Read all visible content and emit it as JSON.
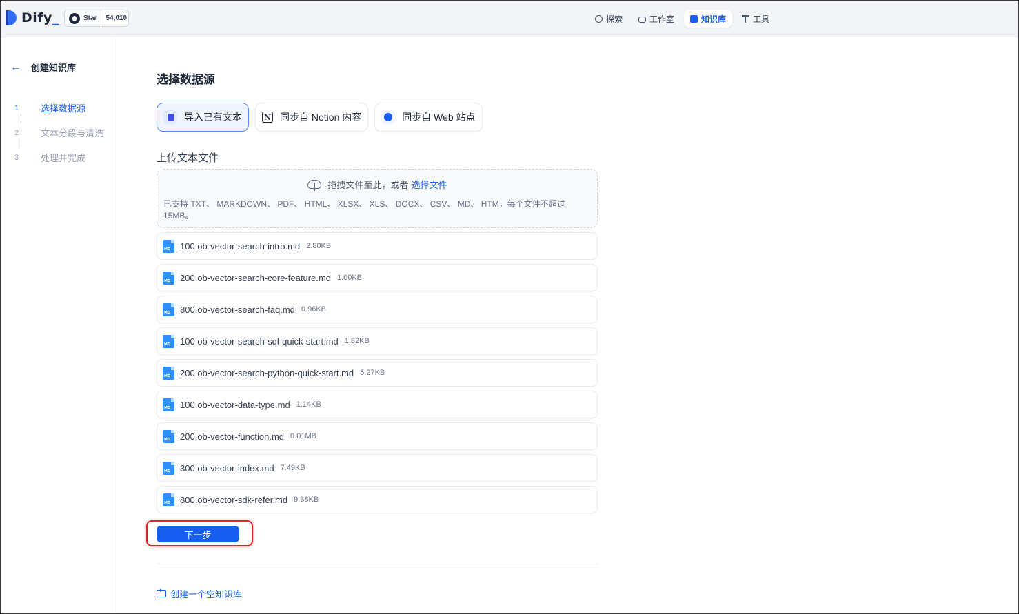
{
  "header": {
    "logo_text": "Dify",
    "github": {
      "star_label": "Star",
      "star_count": "54,010"
    },
    "nav": [
      {
        "label": "探索",
        "icon": "explore-icon",
        "active": false
      },
      {
        "label": "工作室",
        "icon": "studio-icon",
        "active": false
      },
      {
        "label": "知识库",
        "icon": "knowledge-icon",
        "active": true
      },
      {
        "label": "工具",
        "icon": "tools-icon",
        "active": false
      }
    ]
  },
  "sidebar": {
    "back_icon": "arrow-left-icon",
    "title": "创建知识库",
    "steps": [
      {
        "num": "1",
        "label": "选择数据源",
        "active": true
      },
      {
        "num": "2",
        "label": "文本分段与清洗",
        "active": false
      },
      {
        "num": "3",
        "label": "处理并完成",
        "active": false
      }
    ]
  },
  "main": {
    "title": "选择数据源",
    "source_tabs": [
      {
        "label": "导入已有文本",
        "icon": "file-text-icon",
        "active": true
      },
      {
        "label": "同步自 Notion 内容",
        "icon": "notion-icon",
        "active": false
      },
      {
        "label": "同步自 Web 站点",
        "icon": "globe-icon",
        "active": false
      }
    ],
    "upload": {
      "label": "上传文本文件",
      "drop_text": "拖拽文件至此，或者",
      "select_link": "选择文件",
      "hint": "已支持 TXT、 MARKDOWN、 PDF、 HTML、 XLSX、 XLS、 DOCX、 CSV、 MD、 HTM，每个文件不超过 15MB。"
    },
    "files": [
      {
        "name": "100.ob-vector-search-intro.md",
        "size": "2.80KB"
      },
      {
        "name": "200.ob-vector-search-core-feature.md",
        "size": "1.00KB"
      },
      {
        "name": "800.ob-vector-search-faq.md",
        "size": "0.96KB"
      },
      {
        "name": "100.ob-vector-search-sql-quick-start.md",
        "size": "1.82KB"
      },
      {
        "name": "200.ob-vector-search-python-quick-start.md",
        "size": "5.27KB"
      },
      {
        "name": "100.ob-vector-data-type.md",
        "size": "1.14KB"
      },
      {
        "name": "200.ob-vector-function.md",
        "size": "0.01MB"
      },
      {
        "name": "300.ob-vector-index.md",
        "size": "7.49KB"
      },
      {
        "name": "800.ob-vector-sdk-refer.md",
        "size": "9.38KB"
      }
    ],
    "next_button": "下一步",
    "create_empty": "创建一个空知识库"
  },
  "colors": {
    "accent": "#155eef",
    "highlight": "#e02424"
  }
}
